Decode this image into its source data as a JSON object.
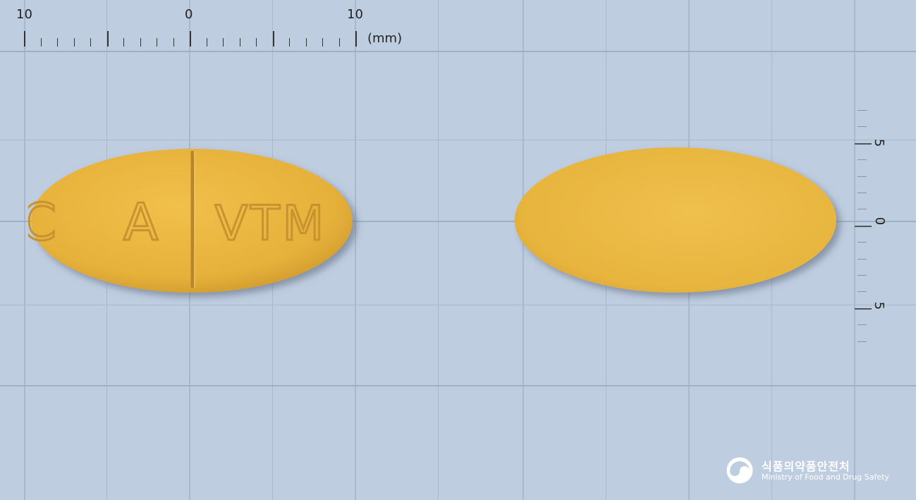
{
  "ruler_top": {
    "labels": [
      "10",
      "0",
      "10"
    ],
    "unit": "(mm)"
  },
  "ruler_right": {
    "labels": [
      "5",
      "0",
      "5"
    ]
  },
  "tablet_front": {
    "imprint_left": "C A",
    "imprint_right": "VTM",
    "color": "#e9b53c"
  },
  "tablet_back": {
    "color": "#eab93f"
  },
  "background_color": "#bfcde0",
  "logo": {
    "korean": "식품의약품안전처",
    "english": "Ministry of Food and Drug Safety"
  }
}
